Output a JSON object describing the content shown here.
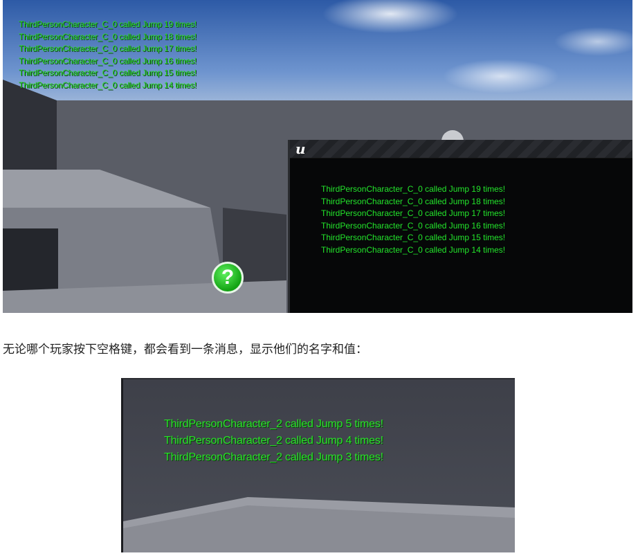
{
  "screenshot_top": {
    "overlay_messages": [
      "ThirdPersonCharacter_C_0 called Jump 19 times!",
      "ThirdPersonCharacter_C_0 called Jump 18 times!",
      "ThirdPersonCharacter_C_0 called Jump 17 times!",
      "ThirdPersonCharacter_C_0 called Jump 16 times!",
      "ThirdPersonCharacter_C_0 called Jump 15 times!",
      "ThirdPersonCharacter_C_0 called Jump 14 times!"
    ],
    "game_window": {
      "logo": "u",
      "messages": [
        "ThirdPersonCharacter_C_0 called Jump 19 times!",
        "ThirdPersonCharacter_C_0 called Jump 18 times!",
        "ThirdPersonCharacter_C_0 called Jump 17 times!",
        "ThirdPersonCharacter_C_0 called Jump 16 times!",
        "ThirdPersonCharacter_C_0 called Jump 15 times!",
        "ThirdPersonCharacter_C_0 called Jump 14 times!"
      ]
    },
    "help_icon_glyph": "?"
  },
  "caption": "无论哪个玩家按下空格键，都会看到一条消息，显示他们的名字和值：",
  "screenshot_bottom": {
    "messages": [
      "ThirdPersonCharacter_2 called Jump 5 times!",
      "ThirdPersonCharacter_2 called Jump 4 times!",
      "ThirdPersonCharacter_2 called Jump 3 times!"
    ]
  },
  "colors": {
    "message_green": "#2adf2a",
    "help_icon_green": "#13a313"
  }
}
